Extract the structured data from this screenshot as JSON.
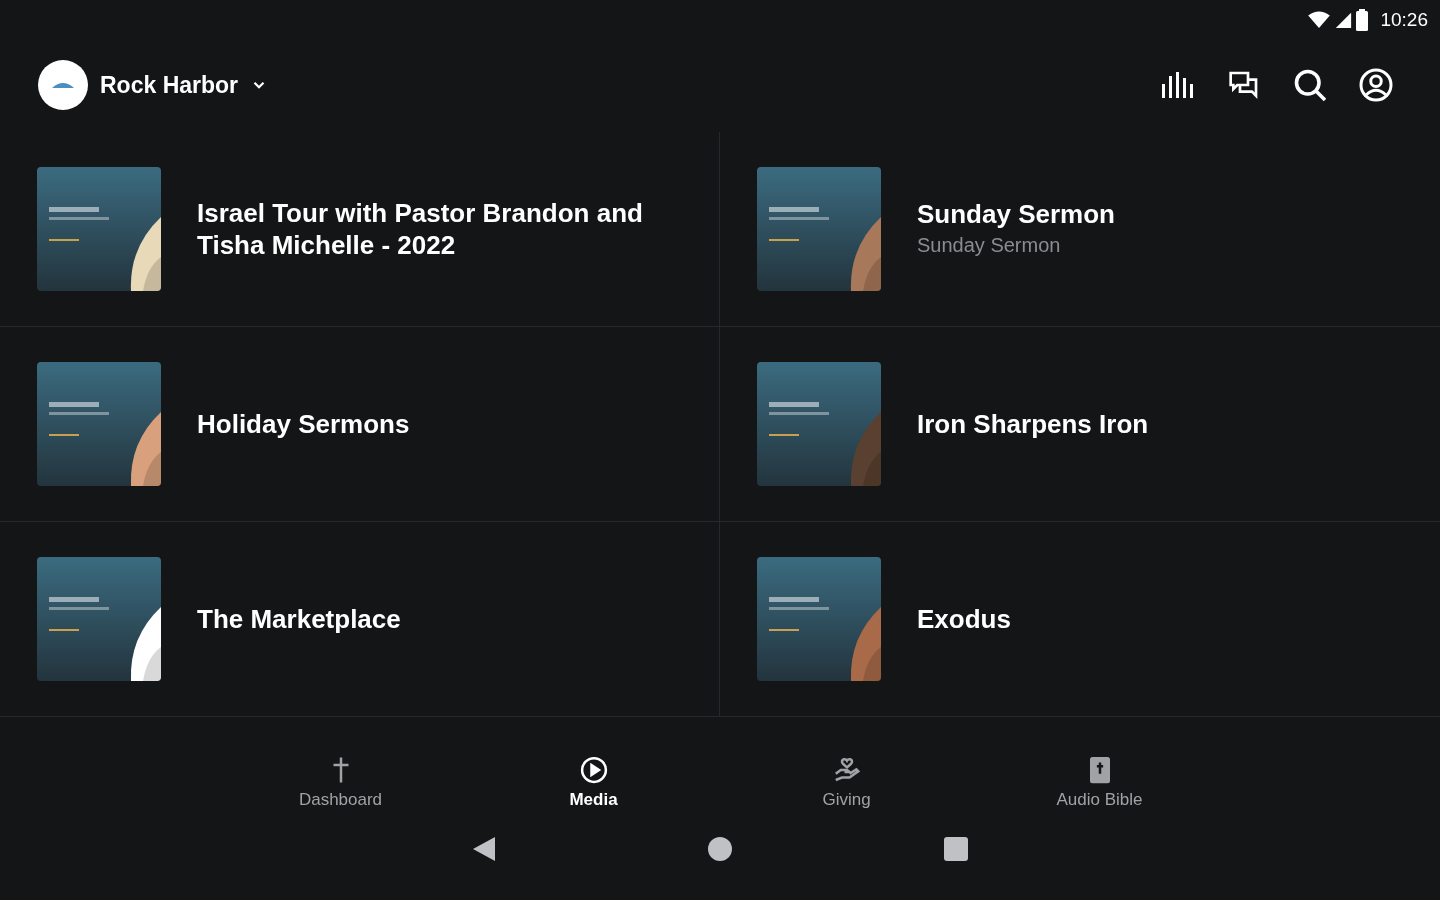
{
  "status_bar": {
    "time": "10:26"
  },
  "header": {
    "church": "Rock Harbor"
  },
  "media": [
    {
      "title": "Israel Tour with Pastor Brandon and Tisha Michelle - 2022"
    },
    {
      "title": "Sunday Sermon",
      "subtitle": "Sunday Sermon"
    },
    {
      "title": "Holiday Sermons"
    },
    {
      "title": "Iron Sharpens Iron"
    },
    {
      "title": "The Marketplace"
    },
    {
      "title": "Exodus"
    }
  ],
  "tabs": [
    {
      "kind": "cross",
      "label": "Dashboard",
      "selected": false
    },
    {
      "kind": "play",
      "label": "Media",
      "selected": true
    },
    {
      "kind": "giving",
      "label": "Giving",
      "selected": false
    },
    {
      "kind": "bible",
      "label": "Audio Bible",
      "selected": false
    }
  ]
}
